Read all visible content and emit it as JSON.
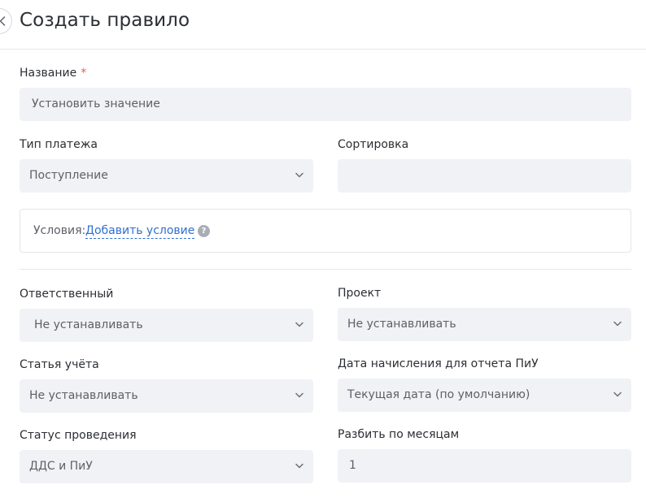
{
  "header": {
    "title": "Создать правило"
  },
  "name_field": {
    "label": "Название",
    "required_mark": "*",
    "value": "Установить значение"
  },
  "payment_type": {
    "label": "Тип платежа",
    "value": "Поступление"
  },
  "sorting": {
    "label": "Сортировка",
    "value": ""
  },
  "conditions": {
    "label": "Условия:",
    "add_link": "Добавить условие",
    "help_glyph": "?"
  },
  "responsible": {
    "label": "Ответственный",
    "value": "Не устанавливать"
  },
  "project": {
    "label": "Проект",
    "value": "Не устанавливать"
  },
  "account_item": {
    "label": "Статья учёта",
    "value": "Не устанавливать"
  },
  "accrual_date": {
    "label": "Дата начисления для отчета ПиУ",
    "value": "Текущая дата (по умолчанию)"
  },
  "posting_status": {
    "label": "Статус проведения",
    "value": "ДДС и ПиУ"
  },
  "split_months": {
    "label": "Разбить по месяцам",
    "value": "1"
  },
  "colors": {
    "field_bg": "#f1f2f6",
    "link": "#2f6fd1",
    "required": "#f05a4f",
    "help_bg": "#a8aeb6"
  },
  "icons": {
    "back": "chevron-left-icon",
    "select": "chevron-down-icon",
    "help": "question-circle-icon"
  }
}
